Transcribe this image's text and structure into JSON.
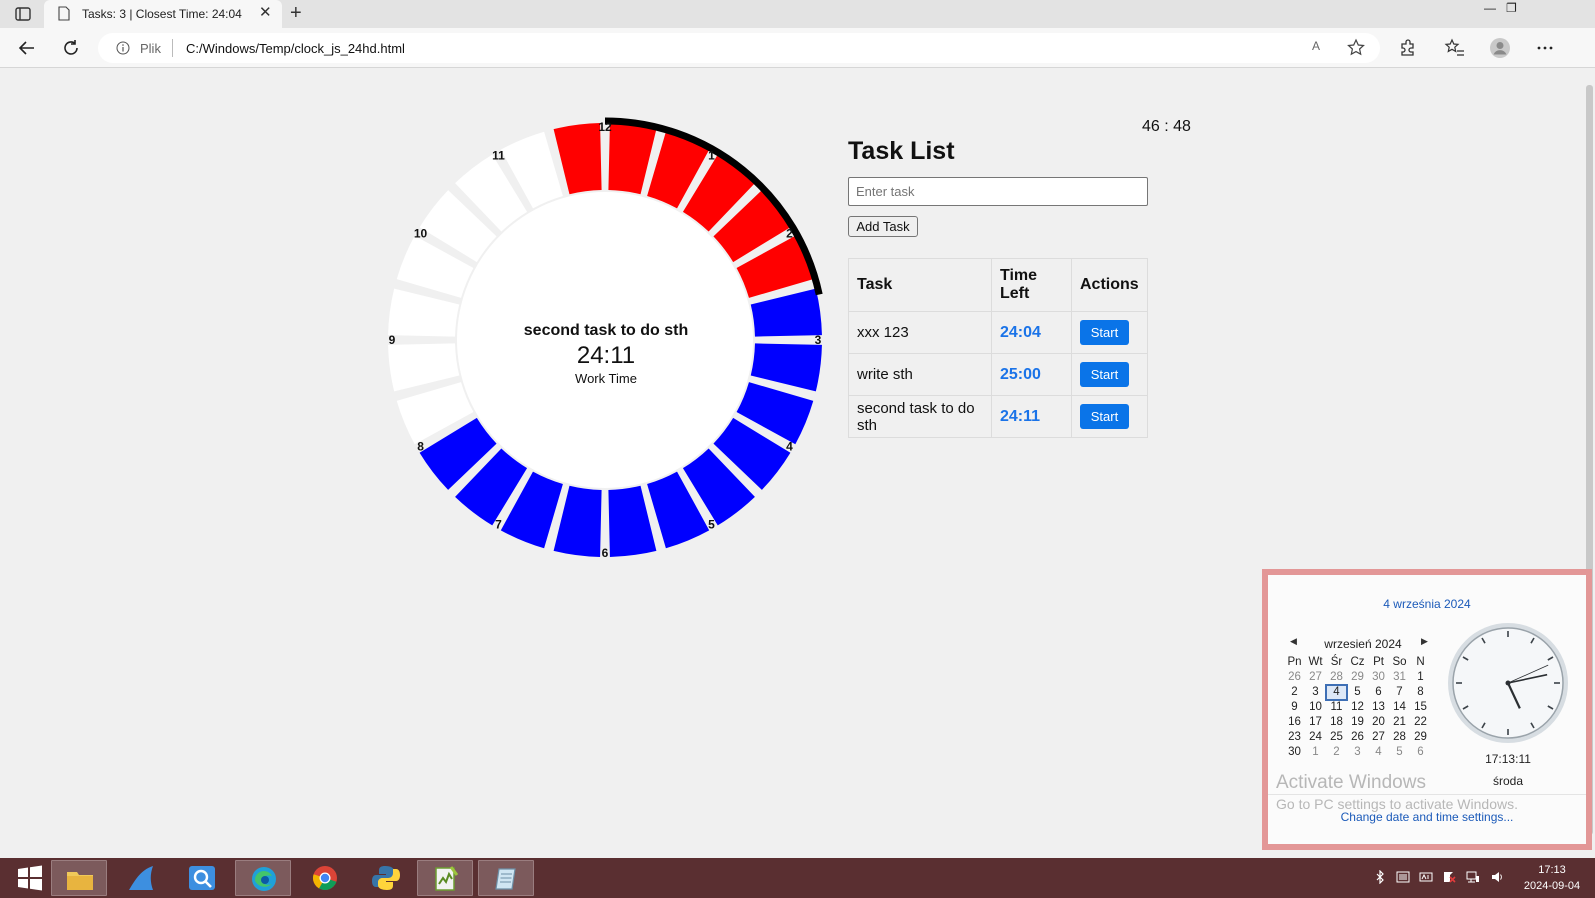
{
  "browser": {
    "tab_title": "Tasks: 3 | Closest Time: 24:04",
    "tab_close": "✕",
    "new_tab": "+",
    "address_scheme": "Plik",
    "address_url": "C:/Windows/Temp/clock_js_24hd.html",
    "read_aloud": "A",
    "window_minimize": "—",
    "window_restore": "❐"
  },
  "page": {
    "clock": {
      "hour_labels": [
        "12",
        "1",
        "2",
        "3",
        "4",
        "5",
        "6",
        "7",
        "8",
        "9",
        "10",
        "11"
      ],
      "segment_colors": {
        "work": "#ff0000",
        "break": "#0000ff",
        "empty": "#ffffff"
      },
      "progress_arc_color": "#000000",
      "center_task": "second task to do sth",
      "center_time": "24:11",
      "center_label": "Work Time"
    },
    "digital_clock": "46 : 48",
    "task_list": {
      "title": "Task List",
      "input_placeholder": "Enter task",
      "add_button": "Add Task",
      "columns": [
        "Task",
        "Time Left",
        "Actions"
      ],
      "rows": [
        {
          "task": "xxx 123",
          "time_left": "24:04",
          "action": "Start"
        },
        {
          "task": "write sth",
          "time_left": "25:00",
          "action": "Start"
        },
        {
          "task": "second task to do sth",
          "time_left": "24:11",
          "action": "Start"
        }
      ]
    }
  },
  "calendar_flyout": {
    "date_long": "4 września 2024",
    "month_label": "wrzesień 2024",
    "weekday_headers": [
      "Pn",
      "Wt",
      "Śr",
      "Cz",
      "Pt",
      "So",
      "N"
    ],
    "weeks": [
      [
        "26",
        "27",
        "28",
        "29",
        "30",
        "31",
        "1"
      ],
      [
        "2",
        "3",
        "4",
        "5",
        "6",
        "7",
        "8"
      ],
      [
        "9",
        "10",
        "11",
        "12",
        "13",
        "14",
        "15"
      ],
      [
        "16",
        "17",
        "18",
        "19",
        "20",
        "21",
        "22"
      ],
      [
        "23",
        "24",
        "25",
        "26",
        "27",
        "28",
        "29"
      ],
      [
        "30",
        "1",
        "2",
        "3",
        "4",
        "5",
        "6"
      ]
    ],
    "selected_day": "4",
    "time": "17:13:11",
    "weekday": "środa",
    "watermark_title": "Activate Windows",
    "watermark_subtitle": "Go to PC settings to activate Windows.",
    "settings_link": "Change date and time settings..."
  },
  "taskbar": {
    "apps": [
      "start-button",
      "file-explorer",
      "sharkfin-app",
      "search-app",
      "edge",
      "chrome",
      "python",
      "notepad-plus",
      "notepad"
    ],
    "tray_time": "17:13",
    "tray_date": "2024-09-04"
  }
}
